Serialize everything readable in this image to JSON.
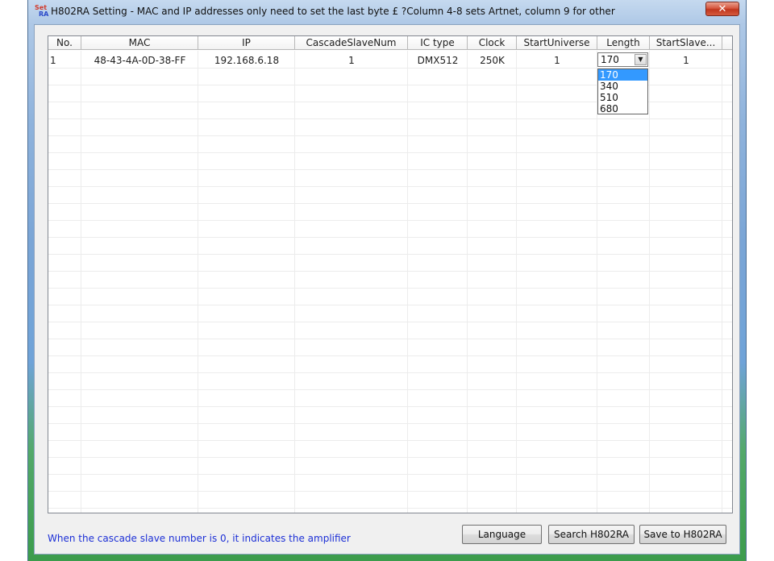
{
  "window": {
    "title": "H802RA Setting - MAC and IP addresses only need to set the last byte £ ?Column 4-8 sets Artnet, column 9 for other",
    "icon_top": "Set",
    "icon_bottom": "RA",
    "close_glyph": "✕"
  },
  "table": {
    "columns": [
      "No.",
      "MAC",
      "IP",
      "CascadeSlaveNum",
      "IC type",
      "Clock",
      "StartUniverse",
      "Length",
      "StartSlave..."
    ],
    "rows": [
      {
        "no": "1",
        "mac": "48-43-4A-0D-38-FF",
        "ip": "192.168.6.18",
        "cascade_slave_num": "1",
        "ic_type": "DMX512",
        "clock": "250K",
        "start_universe": "1",
        "length": "170",
        "start_slave": "1"
      }
    ]
  },
  "length_dropdown": {
    "selected": "170",
    "options": [
      "170",
      "340",
      "510",
      "680"
    ],
    "arrow_glyph": "▼"
  },
  "footer": {
    "note": "When the cascade slave number is 0, it indicates the amplifier",
    "buttons": {
      "language": "Language",
      "search": "Search H802RA",
      "save": "Save to H802RA"
    }
  }
}
